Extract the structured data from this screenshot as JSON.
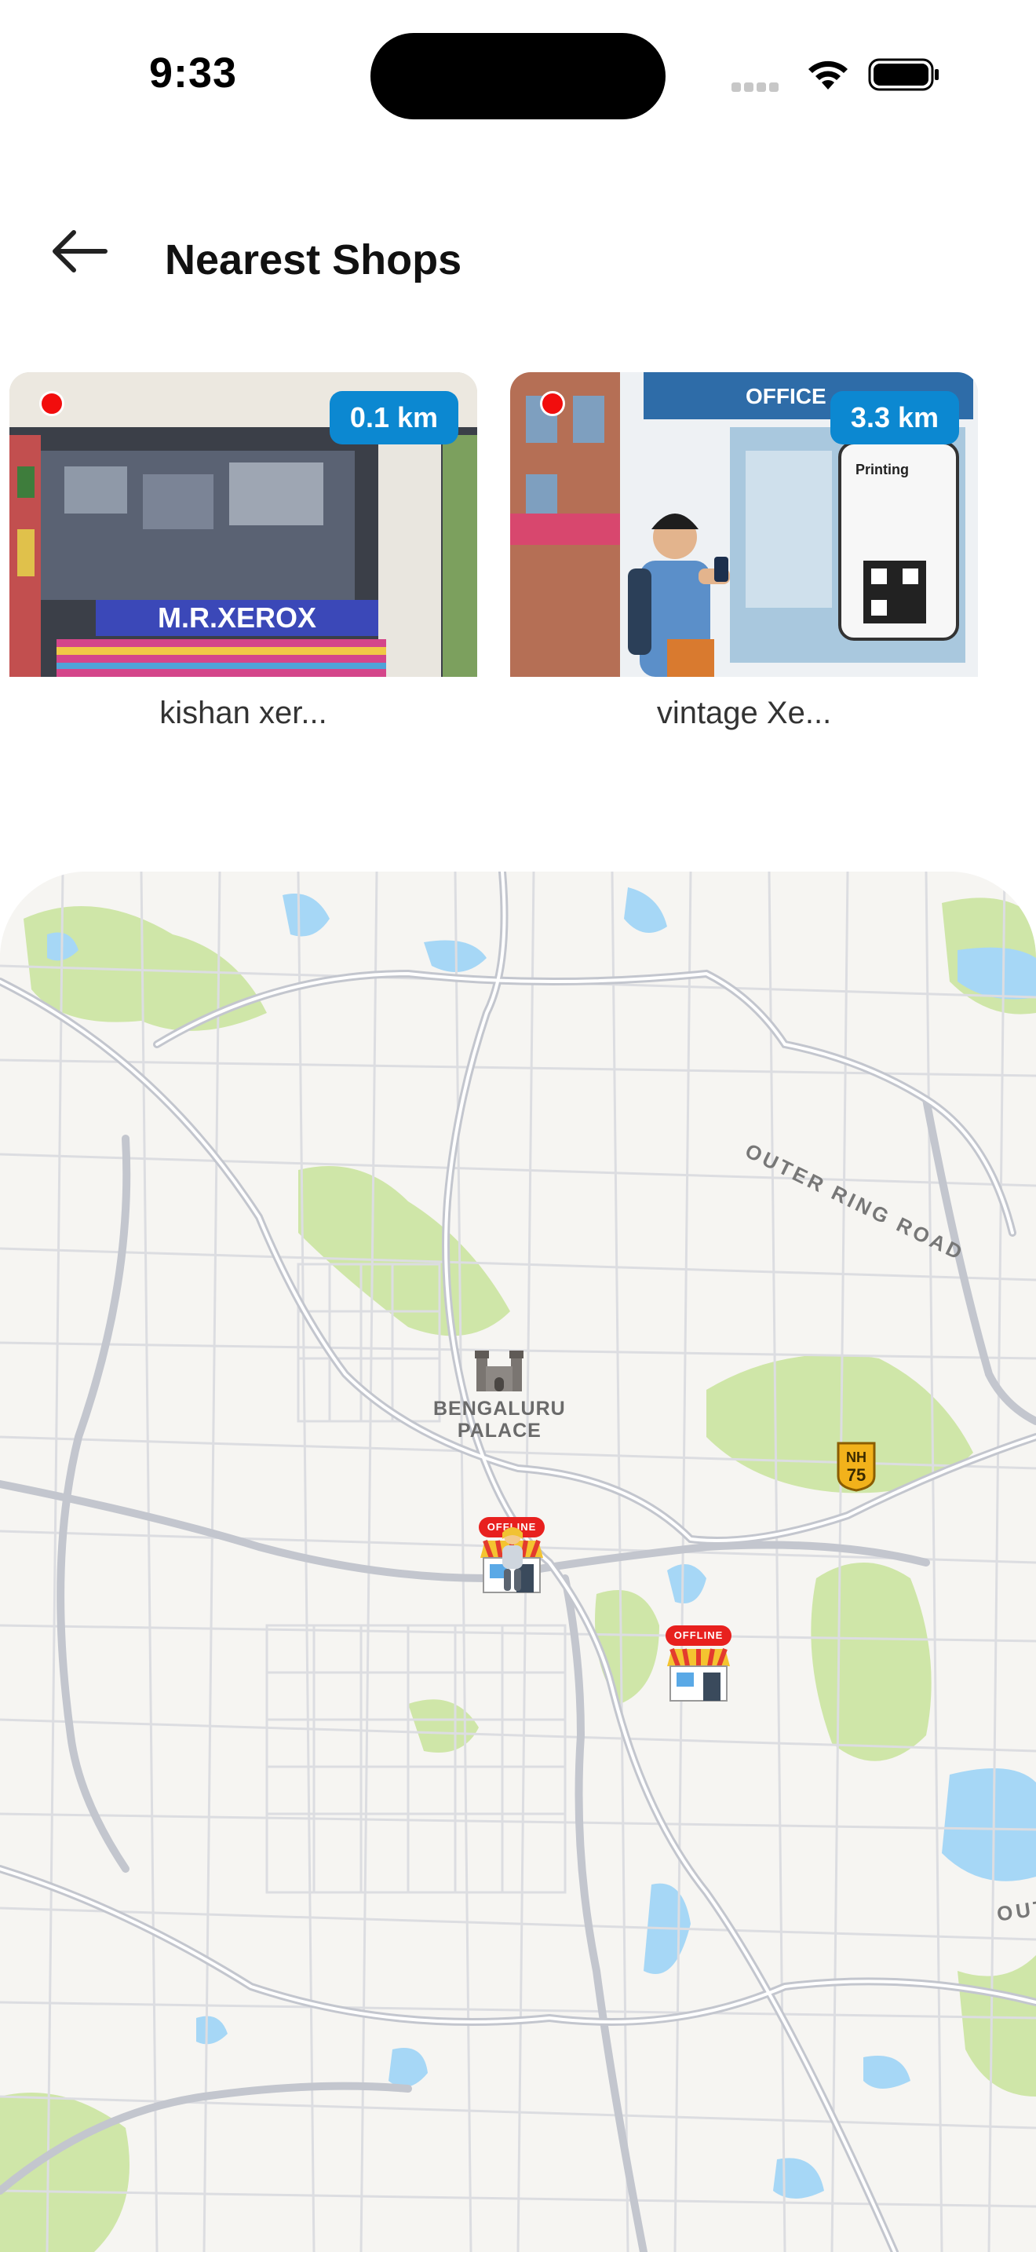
{
  "status_bar": {
    "time": "9:33"
  },
  "header": {
    "back_icon": "arrow-left-icon",
    "title": "Nearest Shops"
  },
  "shops": [
    {
      "name": "kishan xer...",
      "distance": "0.1 km",
      "status_color": "#f20d0d",
      "sign_text": "M.R.XEROX"
    },
    {
      "name": "vintage Xe...",
      "distance": "3.3 km",
      "status_color": "#f20d0d",
      "sign_text": "OFFICE",
      "phone_text": "Printing"
    }
  ],
  "map": {
    "landmark": "BENGALURU PALACE",
    "landmark_line1": "BENGALURU",
    "landmark_line2": "PALACE",
    "road_label": "OUTER RING ROAD",
    "road_label_2": "OUT",
    "highway_line1": "NH",
    "highway_line2": "75",
    "markers": [
      {
        "tag": "OFFLINE",
        "icon": "shop-icon"
      },
      {
        "tag": "OFFLINE",
        "icon": "shop-icon"
      }
    ],
    "user_icon": "person-icon"
  },
  "colors": {
    "accent": "#0c88d1",
    "offline": "#e8201e",
    "park": "#c8e3a1",
    "water": "#9fd3f5",
    "road": "#c7cad1"
  }
}
